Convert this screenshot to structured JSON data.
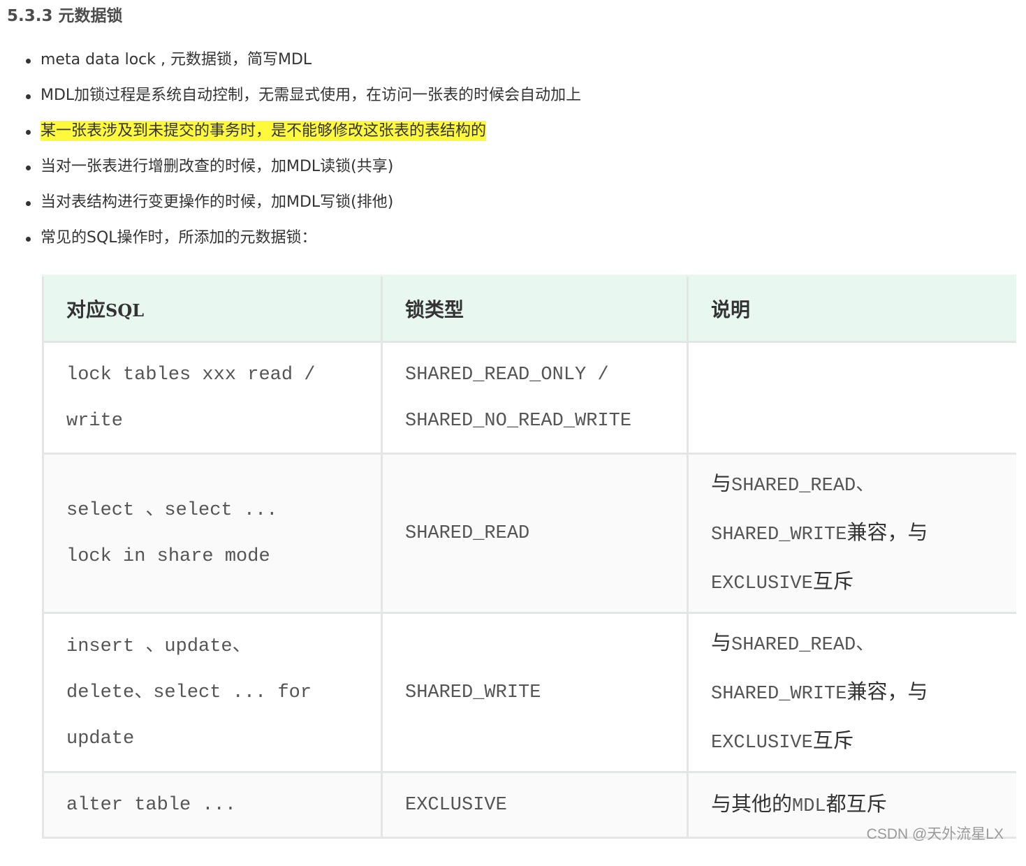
{
  "heading": "5.3.3 元数据锁",
  "bullets": [
    "meta data lock , 元数据锁，简写MDL",
    "MDL加锁过程是系统自动控制，无需显式使用，在访问一张表的时候会自动加上",
    "某一张表涉及到未提交的事务时，是不能够修改这张表的表结构的",
    "当对一张表进行增删改查的时候，加MDL读锁(共享)",
    "当对表结构进行变更操作的时候，加MDL写锁(排他)",
    "常见的SQL操作时，所添加的元数据锁："
  ],
  "highlight_color": "#fff93b",
  "table": {
    "header": {
      "col1_cjk": "对应",
      "col1_sql": "SQL",
      "col2": "锁类型",
      "col3": "说明"
    },
    "rows": [
      {
        "sql": [
          "lock tables xxx read /",
          "write"
        ],
        "lock_type": [
          "SHARED_READ_ONLY /",
          "SHARED_NO_READ_WRITE"
        ],
        "desc": []
      },
      {
        "sql": [
          "select 、select ...",
          "lock in share mode"
        ],
        "lock_type": [
          "SHARED_READ"
        ],
        "desc": [
          {
            "a": "与",
            "b": "SHARED_READ、"
          },
          {
            "a": "",
            "b": "SHARED_WRITE",
            "c": "兼容，与"
          },
          {
            "a": "",
            "b": "EXCLUSIVE",
            "c": "互斥"
          }
        ]
      },
      {
        "sql": [
          "insert 、update、",
          "delete、select ... for",
          "update"
        ],
        "lock_type": [
          "SHARED_WRITE"
        ],
        "desc": [
          {
            "a": "与",
            "b": "SHARED_READ、"
          },
          {
            "a": "",
            "b": "SHARED_WRITE",
            "c": "兼容，与"
          },
          {
            "a": "",
            "b": "EXCLUSIVE",
            "c": "互斥"
          }
        ]
      },
      {
        "sql": [
          "alter table ..."
        ],
        "lock_type": [
          "EXCLUSIVE"
        ],
        "desc": [
          {
            "a": "与其他的",
            "b": "MDL",
            "c": "都互斥"
          }
        ]
      }
    ]
  },
  "header_bg": "#e8f7f0",
  "watermark": "CSDN @天外流星LX"
}
